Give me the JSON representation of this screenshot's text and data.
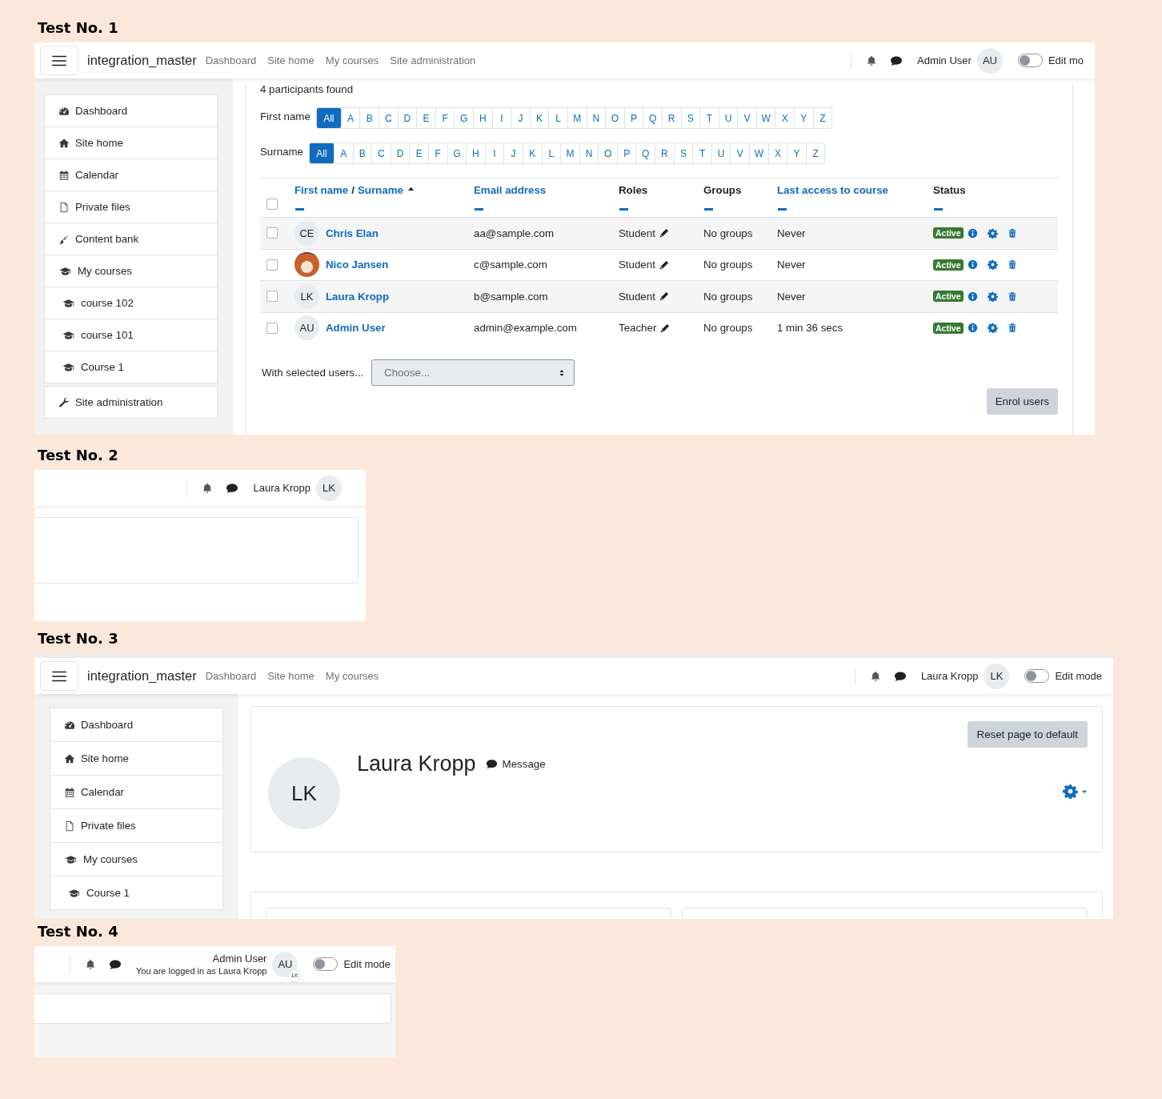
{
  "tests": [
    {
      "title": "Test No. 1",
      "kind": "participants",
      "navbar": {
        "site_name": "integration_master",
        "links": [
          "Dashboard",
          "Site home",
          "My courses",
          "Site administration"
        ],
        "user": {
          "name": "Admin User",
          "initials": "AU"
        },
        "edit_mode": {
          "label": "Edit mo",
          "on": false
        }
      },
      "sidebar": [
        {
          "label": "Dashboard",
          "kind": "dashboard"
        },
        {
          "label": "Site home",
          "kind": "home"
        },
        {
          "label": "Calendar",
          "kind": "calendar"
        },
        {
          "label": "Private files",
          "kind": "files"
        },
        {
          "label": "Content bank",
          "kind": "content"
        },
        {
          "label": "My courses",
          "kind": "courses"
        },
        {
          "label": "course 102",
          "kind": "course"
        },
        {
          "label": "course 101",
          "kind": "course"
        },
        {
          "label": "Course 1",
          "kind": "course"
        },
        {
          "label": "Site administration",
          "kind": "admin"
        }
      ],
      "participants": {
        "count": "4 participants found",
        "filters": [
          {
            "label": "First name",
            "letters": [
              {
                "label": "All",
                "selected": true
              },
              {
                "label": "A",
                "selected": false
              },
              {
                "label": "B",
                "selected": false
              },
              {
                "label": "C",
                "selected": false
              },
              {
                "label": "D",
                "selected": false
              },
              {
                "label": "E",
                "selected": false
              },
              {
                "label": "F",
                "selected": false
              },
              {
                "label": "G",
                "selected": false
              },
              {
                "label": "H",
                "selected": false
              },
              {
                "label": "I",
                "selected": false
              },
              {
                "label": "J",
                "selected": false
              },
              {
                "label": "K",
                "selected": false
              },
              {
                "label": "L",
                "selected": false
              },
              {
                "label": "M",
                "selected": false
              },
              {
                "label": "N",
                "selected": false
              },
              {
                "label": "O",
                "selected": false
              },
              {
                "label": "P",
                "selected": false
              },
              {
                "label": "Q",
                "selected": false
              },
              {
                "label": "R",
                "selected": false
              },
              {
                "label": "S",
                "selected": false
              },
              {
                "label": "T",
                "selected": false
              },
              {
                "label": "U",
                "selected": false
              },
              {
                "label": "V",
                "selected": false
              },
              {
                "label": "W",
                "selected": false
              },
              {
                "label": "X",
                "selected": false
              },
              {
                "label": "Y",
                "selected": false
              },
              {
                "label": "Z",
                "selected": false
              }
            ]
          },
          {
            "label": "Surname",
            "letters": [
              {
                "label": "All",
                "selected": true
              },
              {
                "label": "A",
                "selected": false
              },
              {
                "label": "B",
                "selected": false
              },
              {
                "label": "C",
                "selected": false
              },
              {
                "label": "D",
                "selected": false
              },
              {
                "label": "E",
                "selected": false
              },
              {
                "label": "F",
                "selected": false
              },
              {
                "label": "G",
                "selected": false
              },
              {
                "label": "H",
                "selected": false
              },
              {
                "label": "I",
                "selected": false
              },
              {
                "label": "J",
                "selected": false
              },
              {
                "label": "K",
                "selected": false
              },
              {
                "label": "L",
                "selected": false
              },
              {
                "label": "M",
                "selected": false
              },
              {
                "label": "N",
                "selected": false
              },
              {
                "label": "O",
                "selected": false
              },
              {
                "label": "P",
                "selected": false
              },
              {
                "label": "Q",
                "selected": false
              },
              {
                "label": "R",
                "selected": false
              },
              {
                "label": "S",
                "selected": false
              },
              {
                "label": "T",
                "selected": false
              },
              {
                "label": "U",
                "selected": false
              },
              {
                "label": "V",
                "selected": false
              },
              {
                "label": "W",
                "selected": false
              },
              {
                "label": "X",
                "selected": false
              },
              {
                "label": "Y",
                "selected": false
              },
              {
                "label": "Z",
                "selected": false
              }
            ]
          }
        ],
        "select_all": {
          "checked": false
        },
        "columns": [
          {
            "kind": "name",
            "links": [
              "First name",
              "Surname"
            ],
            "separator": "/",
            "sorted_ascending": true
          },
          {
            "kind": "link",
            "label": "Email address"
          },
          {
            "kind": "plain",
            "label": "Roles"
          },
          {
            "kind": "plain",
            "label": "Groups"
          },
          {
            "kind": "link",
            "label": "Last access to course"
          },
          {
            "kind": "plain",
            "label": "Status"
          }
        ],
        "rows": [
          {
            "checked": false,
            "avatar": {
              "kind": "initials",
              "initials": "CE"
            },
            "name": "Chris Elan",
            "email": "aa@sample.com",
            "role": "Student",
            "groups": "No groups",
            "last_access": "Never",
            "status": "Active"
          },
          {
            "checked": false,
            "avatar": {
              "kind": "photo"
            },
            "name": "Nico Jansen",
            "email": "c@sample.com",
            "role": "Student",
            "groups": "No groups",
            "last_access": "Never",
            "status": "Active"
          },
          {
            "checked": false,
            "avatar": {
              "kind": "initials",
              "initials": "LK"
            },
            "name": "Laura Kropp",
            "email": "b@sample.com",
            "role": "Student",
            "groups": "No groups",
            "last_access": "Never",
            "status": "Active"
          },
          {
            "checked": false,
            "avatar": {
              "kind": "initials",
              "initials": "AU"
            },
            "name": "Admin User",
            "email": "admin@example.com",
            "role": "Teacher",
            "groups": "No groups",
            "last_access": "1 min 36 secs",
            "status": "Active"
          }
        ],
        "bulk": {
          "label": "With selected users...",
          "value": "Choose..."
        },
        "enrol_button": "Enrol users"
      }
    },
    {
      "title": "Test No. 2",
      "kind": "empty",
      "navbar": {
        "user": {
          "name": "Laura Kropp",
          "initials": "LK"
        }
      }
    },
    {
      "title": "Test No. 3",
      "kind": "profile",
      "navbar": {
        "site_name": "integration_master",
        "links": [
          "Dashboard",
          "Site home",
          "My courses"
        ],
        "user": {
          "name": "Laura Kropp",
          "initials": "LK"
        },
        "edit_mode": {
          "label": "Edit mode",
          "on": false
        }
      },
      "sidebar": [
        {
          "label": "Dashboard",
          "kind": "dashboard"
        },
        {
          "label": "Site home",
          "kind": "home"
        },
        {
          "label": "Calendar",
          "kind": "calendar"
        },
        {
          "label": "Private files",
          "kind": "files"
        },
        {
          "label": "My courses",
          "kind": "courses"
        },
        {
          "label": "Course 1",
          "kind": "course"
        }
      ],
      "profile": {
        "name": "Laura Kropp",
        "initials": "LK",
        "message": "Message",
        "reset_button": "Reset page to default"
      }
    },
    {
      "title": "Test No. 4",
      "kind": "shaded",
      "navbar": {
        "user": {
          "name": "Admin User",
          "subtitle": "You are logged in as Laura Kropp",
          "initials": "AU",
          "badge": "LK"
        },
        "edit_mode": {
          "label": "Edit mode",
          "on": false
        }
      }
    }
  ]
}
